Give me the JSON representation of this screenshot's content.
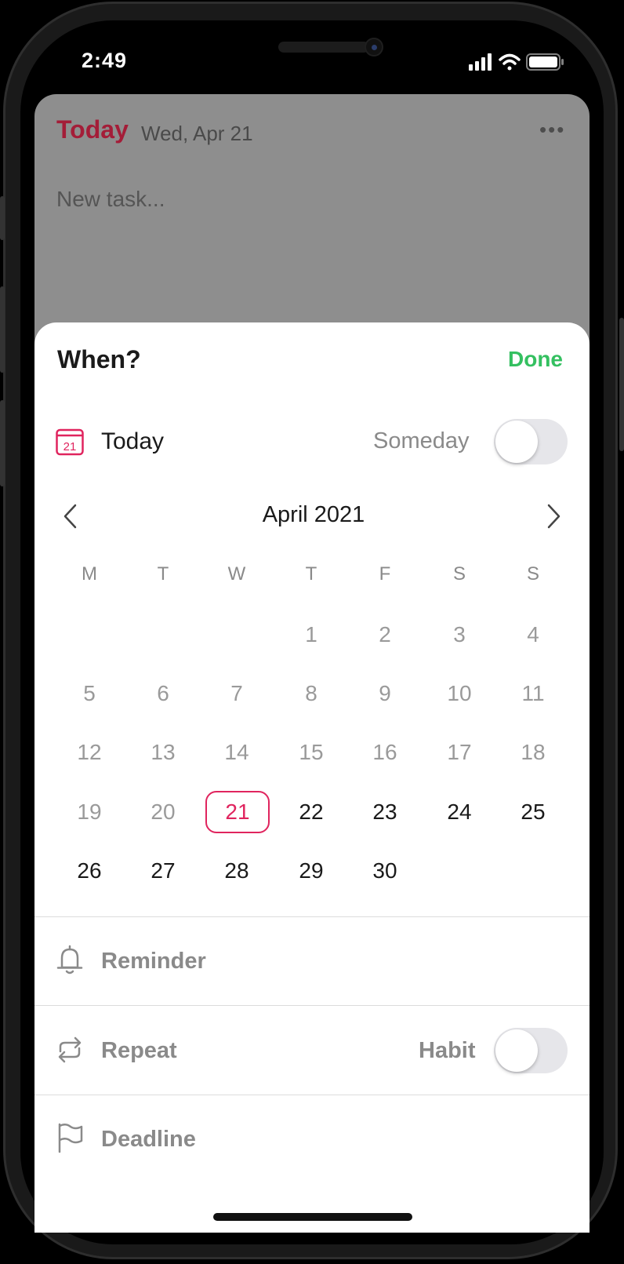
{
  "status_bar": {
    "time": "2:49"
  },
  "backdrop": {
    "title": "Today",
    "date": "Wed, Apr 21",
    "more": "•••",
    "new_task_placeholder": "New task..."
  },
  "sheet": {
    "title": "When?",
    "done_label": "Done",
    "today_row": {
      "icon_day": "21",
      "label": "Today",
      "someday_label": "Someday",
      "someday_on": false
    },
    "calendar": {
      "month_label": "April 2021",
      "weekdays": [
        "M",
        "T",
        "W",
        "T",
        "F",
        "S",
        "S"
      ],
      "selected_day": "21",
      "weeks": [
        [
          "",
          "",
          "",
          "1",
          "2",
          "3",
          "4"
        ],
        [
          "5",
          "6",
          "7",
          "8",
          "9",
          "10",
          "11"
        ],
        [
          "12",
          "13",
          "14",
          "15",
          "16",
          "17",
          "18"
        ],
        [
          "19",
          "20",
          "21",
          "22",
          "23",
          "24",
          "25"
        ],
        [
          "26",
          "27",
          "28",
          "29",
          "30",
          "",
          ""
        ]
      ]
    },
    "reminder_label": "Reminder",
    "repeat_label": "Repeat",
    "habit_label": "Habit",
    "habit_on": false,
    "deadline_label": "Deadline"
  },
  "colors": {
    "accent_red": "#e0245e",
    "done_green": "#34c060",
    "title_red": "#a41d38"
  }
}
